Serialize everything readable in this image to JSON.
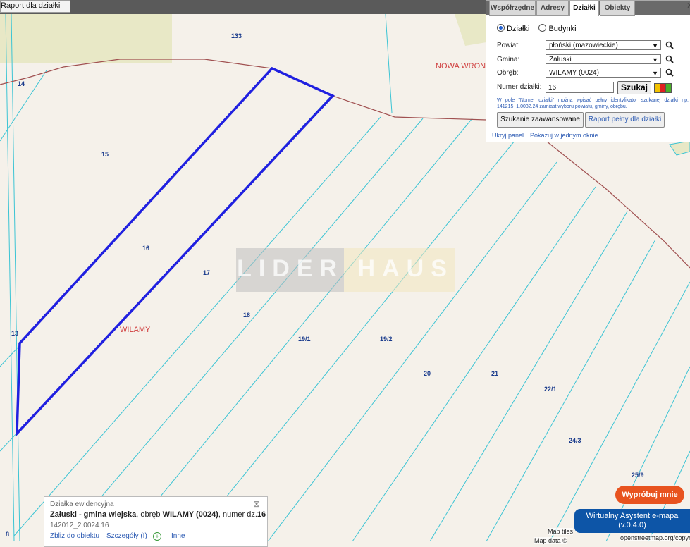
{
  "report_button": "Raport dla działki",
  "map": {
    "parcel_labels": [
      "133",
      "14",
      "15",
      "16",
      "17",
      "18",
      "19/1",
      "19/2",
      "20",
      "21",
      "22/1",
      "24/3",
      "25/9",
      "13",
      "8"
    ],
    "area_labels": [
      "NOWA WRON",
      "WILAMY"
    ],
    "watermark_left": "LIDER",
    "watermark_right": "HAUS"
  },
  "panel": {
    "tabs": [
      "Współrzędne",
      "Adresy",
      "Działki",
      "Obiekty"
    ],
    "active_tab": "Działki",
    "radio_dzialki": "Działki",
    "radio_budynki": "Budynki",
    "powiat_label": "Powiat:",
    "powiat_value": "płoński (mazowieckie)",
    "gmina_label": "Gmina:",
    "gmina_value": "Załuski",
    "obreb_label": "Obręb:",
    "obreb_value": "WILAMY (0024)",
    "numer_label": "Numer działki:",
    "numer_value": "16",
    "search_button": "Szukaj",
    "hint": "W pole \"Numer działki\" można wpisać pełny identyfikator szukanej działki np. 141215_1.0032.24 zamiast wyboru powiatu, gminy, obrębu.",
    "advanced_button": "Szukanie zaawansowane",
    "full_report_button": "Raport pełny dla działki",
    "hide_link": "Ukryj panel",
    "one_window_link": "Pokazuj w jednym oknie"
  },
  "info": {
    "title": "Działka ewidencyjna",
    "desc_prefix": "Załuski - gmina wiejska",
    "desc_mid": ", obręb ",
    "desc_obreb": "WILAMY (0024)",
    "desc_num_label": ", numer dz.",
    "desc_num": "16",
    "identifier": "142012_2.0024.16",
    "zoom_link": "Zbliż do obiektu",
    "details_link": "Szczegóły (I)",
    "other_link": "Inne"
  },
  "try_button": "Wypróbuj mnie",
  "assistant_line1": "Wirtualny Asystent e-mapa",
  "assistant_line2": "(v.0.4.0)",
  "attribution_1": "Map tiles",
  "attribution_2": "Map data ©",
  "attribution_3": "openstreetmap.org/copyr",
  "colors": {
    "parcel_border": "#2020e0",
    "cadastral_lines": "#3cc4d4",
    "boundary": "#a05050",
    "accent": "#e8531f",
    "assistant": "#0d55a7"
  }
}
